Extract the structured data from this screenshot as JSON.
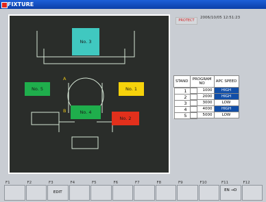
{
  "window": {
    "title": "FIXTURE"
  },
  "header": {
    "protect_label": "PROTECT",
    "datetime": "2006/10/05 12:51:23"
  },
  "layout_labels": {
    "a": "A",
    "b": "B"
  },
  "stands": [
    {
      "id": "no3",
      "label": "No. 3",
      "color": "#40c8c0",
      "text_color": "#1a1a1a"
    },
    {
      "id": "no5",
      "label": "No. 5",
      "color": "#1fae4c",
      "text_color": "#1a1a1a"
    },
    {
      "id": "no1",
      "label": "No. 1",
      "color": "#f6d20b",
      "text_color": "#1a1a1a"
    },
    {
      "id": "no4",
      "label": "No. 4",
      "color": "#1fae4c",
      "text_color": "#1a1a1a"
    },
    {
      "id": "no2",
      "label": "No. 2",
      "color": "#e2301c",
      "text_color": "#1a1a1a"
    }
  ],
  "table": {
    "headers": [
      "STAND",
      "PROGRAM NO",
      "APC SPEED"
    ],
    "rows": [
      {
        "stand": "1",
        "program": "1000",
        "apc": "HIGH"
      },
      {
        "stand": "2",
        "program": "2000",
        "apc": "HIGH"
      },
      {
        "stand": "3",
        "program": "3000",
        "apc": "LOW"
      },
      {
        "stand": "4",
        "program": "4000",
        "apc": "HIGH"
      },
      {
        "stand": "5",
        "program": "5000",
        "apc": "LOW"
      }
    ]
  },
  "function_keys": [
    {
      "key": "F1",
      "label": ""
    },
    {
      "key": "F2",
      "label": ""
    },
    {
      "key": "F3",
      "label": "EDIT"
    },
    {
      "key": "F4",
      "label": ""
    },
    {
      "key": "F5",
      "label": ""
    },
    {
      "key": "F6",
      "label": ""
    },
    {
      "key": "F7",
      "label": ""
    },
    {
      "key": "F8",
      "label": ""
    },
    {
      "key": "F9",
      "label": ""
    },
    {
      "key": "F10",
      "label": ""
    },
    {
      "key": "F11",
      "label": "EN →D"
    },
    {
      "key": "F12",
      "label": ""
    }
  ]
}
